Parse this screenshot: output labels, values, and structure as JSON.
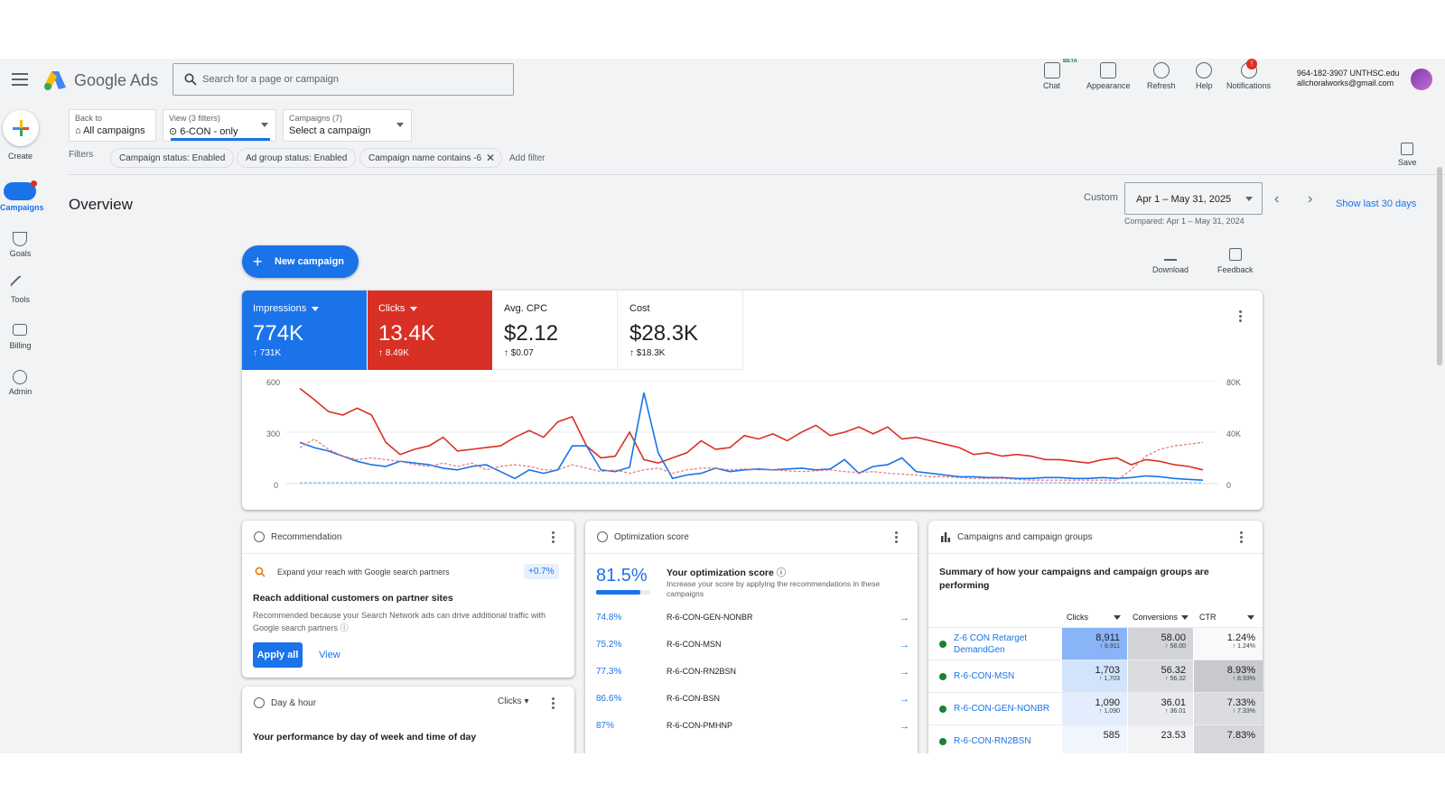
{
  "app": {
    "name": "Google Ads"
  },
  "search": {
    "placeholder": "Search for a page or campaign"
  },
  "header_tools": [
    {
      "label": "Chat",
      "icon": "chat-icon",
      "tag": "BETA"
    },
    {
      "label": "Appearance",
      "icon": "appearance-icon"
    },
    {
      "label": "Refresh",
      "icon": "refresh-icon"
    },
    {
      "label": "Help",
      "icon": "help-icon"
    },
    {
      "label": "Notifications",
      "icon": "bell-icon",
      "badge": "!"
    }
  ],
  "account": {
    "line1": "964-182-3907 UNTHSC.edu",
    "line2": "allchoralworks@gmail.com"
  },
  "sidebar": {
    "create_label": "Create",
    "items": [
      {
        "label": "Campaigns",
        "icon": "megaphone-icon"
      },
      {
        "label": "Goals",
        "icon": "trophy-icon"
      },
      {
        "label": "Tools",
        "icon": "tools-icon"
      },
      {
        "label": "Billing",
        "icon": "billing-icon"
      },
      {
        "label": "Admin",
        "icon": "gear-icon"
      }
    ]
  },
  "breadcrumbs": {
    "back": {
      "small": "Back to",
      "big": "All campaigns"
    },
    "view": {
      "small": "View (3 filters)",
      "big": "6-CON - only"
    },
    "campaigns": {
      "small": "Campaigns (7)",
      "big": "Select a campaign"
    }
  },
  "filters": {
    "label": "Filters",
    "chips": [
      "Campaign status: Enabled",
      "Ad group status: Enabled",
      "Campaign name contains -6"
    ],
    "add": "Add filter"
  },
  "save_label": "Save",
  "overview": {
    "title": "Overview",
    "custom_label": "Custom",
    "date_range": "Apr 1 – May 31, 2025",
    "compared": "Compared: Apr 1 – May 31, 2024",
    "show_last": "Show last 30 days",
    "new_campaign": "New campaign",
    "download": "Download",
    "feedback": "Feedback"
  },
  "metrics": [
    {
      "name": "Impressions",
      "value": "774K",
      "compare": "731K",
      "color": "#1a73e8"
    },
    {
      "name": "Clicks",
      "value": "13.4K",
      "compare": "8.49K",
      "color": "#d93025"
    },
    {
      "name": "Avg. CPC",
      "value": "$2.12",
      "compare": "$0.07"
    },
    {
      "name": "Cost",
      "value": "$28.3K",
      "compare": "$18.3K"
    }
  ],
  "chart_data": {
    "type": "line",
    "left_axis_ticks": [
      "600",
      "300",
      "0"
    ],
    "right_axis_ticks": [
      "80K",
      "40K",
      "0"
    ],
    "ylim_left": [
      0,
      600
    ],
    "ylim_right": [
      0,
      80000
    ],
    "series": [
      {
        "name": "Clicks",
        "color": "#d93025",
        "values": [
          555,
          490,
          420,
          400,
          440,
          400,
          240,
          170,
          200,
          220,
          270,
          190,
          200,
          210,
          220,
          270,
          310,
          270,
          360,
          390,
          220,
          150,
          160,
          300,
          140,
          120,
          150,
          180,
          250,
          200,
          210,
          280,
          260,
          290,
          250,
          300,
          340,
          280,
          300,
          330,
          290,
          330,
          260,
          270,
          250,
          230,
          210,
          170,
          180,
          160,
          170,
          160,
          140,
          140,
          130,
          120,
          140,
          150,
          110,
          140,
          130,
          110,
          100,
          80
        ]
      },
      {
        "name": "Impressions",
        "color": "#1a73e8",
        "values": [
          240,
          210,
          190,
          160,
          130,
          110,
          100,
          130,
          120,
          110,
          90,
          80,
          100,
          110,
          70,
          30,
          80,
          60,
          80,
          220,
          220,
          80,
          70,
          95,
          530,
          180,
          30,
          50,
          60,
          90,
          70,
          80,
          85,
          80,
          85,
          90,
          80,
          85,
          140,
          60,
          100,
          110,
          150,
          70,
          60,
          50,
          40,
          40,
          35,
          35,
          30,
          30,
          35,
          35,
          30,
          30,
          35,
          30,
          35,
          45,
          40,
          30,
          25,
          20
        ]
      },
      {
        "name": "Clicks (compared)",
        "color": "#e57373",
        "dashed": true,
        "values": [
          210,
          260,
          200,
          160,
          140,
          150,
          140,
          130,
          110,
          100,
          120,
          100,
          120,
          80,
          100,
          110,
          100,
          80,
          80,
          110,
          90,
          70,
          80,
          60,
          80,
          90,
          60,
          80,
          90,
          90,
          80,
          85,
          80,
          80,
          75,
          70,
          75,
          80,
          70,
          65,
          70,
          60,
          55,
          50,
          40,
          40,
          35,
          30,
          30,
          30,
          25,
          20,
          20,
          20,
          20,
          20,
          20,
          20,
          80,
          160,
          200,
          220,
          230,
          240
        ]
      },
      {
        "name": "Impressions (compared)",
        "color": "#8ab4f8",
        "dashed": true,
        "values": [
          5,
          5,
          5,
          5,
          5,
          5,
          5,
          5,
          5,
          5,
          5,
          5,
          5,
          5,
          5,
          5,
          5,
          5,
          5,
          5,
          5,
          5,
          5,
          5,
          5,
          5,
          5,
          5,
          5,
          5,
          5,
          5,
          5,
          5,
          5,
          5,
          5,
          5,
          5,
          5,
          5,
          5,
          5,
          5,
          5,
          5,
          5,
          5,
          5,
          5,
          5,
          5,
          5,
          5,
          5,
          5,
          5,
          5,
          5,
          5,
          5,
          5,
          5,
          5
        ]
      }
    ]
  },
  "recommendation": {
    "title": "Recommendation",
    "line": "Expand your reach with Google search partners",
    "badge": "+0.7%",
    "headline": "Reach additional customers on partner sites",
    "body": "Recommended because your Search Network ads can drive additional traffic with Google search partners",
    "apply": "Apply all",
    "view": "View"
  },
  "dayhour": {
    "title": "Day & hour",
    "metric": "Clicks",
    "headline": "Your performance by day of week and time of day"
  },
  "optimization": {
    "title": "Optimization score",
    "score": "81.5%",
    "score_value": 0.815,
    "heading": "Your optimization score",
    "desc": "Increase your score by applying the recommendations in these campaigns",
    "rows": [
      {
        "pct": "74.8%",
        "name": "R-6-CON-GEN-NONBR"
      },
      {
        "pct": "75.2%",
        "name": "R-6-CON-MSN"
      },
      {
        "pct": "77.3%",
        "name": "R-6-CON-RN2BSN"
      },
      {
        "pct": "86.6%",
        "name": "R-6-CON-BSN"
      },
      {
        "pct": "87%",
        "name": "R-6-CON-PMHNP"
      }
    ]
  },
  "campaign_groups": {
    "title": "Campaigns and campaign groups",
    "summary": "Summary of how your campaigns and campaign groups are performing",
    "headers": [
      "Clicks",
      "Conversions",
      "CTR"
    ],
    "rows": [
      {
        "name": "Z-6 CON Retarget DemandGen",
        "clicks": "8,911",
        "clicks_c": "8,911",
        "conv": "58.00",
        "conv_c": "58.00",
        "ctr": "1.24%",
        "ctr_c": "1.24%"
      },
      {
        "name": "R-6-CON-MSN",
        "clicks": "1,703",
        "clicks_c": "1,703",
        "conv": "56.32",
        "conv_c": "56.32",
        "ctr": "8.93%",
        "ctr_c": "8.93%"
      },
      {
        "name": "R-6-CON-GEN-NONBR",
        "clicks": "1,090",
        "clicks_c": "1,090",
        "conv": "36.01",
        "conv_c": "36.01",
        "ctr": "7.33%",
        "ctr_c": "7.33%"
      },
      {
        "name": "R-6-CON-RN2BSN",
        "clicks": "585",
        "clicks_c": "",
        "conv": "23.53",
        "conv_c": "",
        "ctr": "7.83%",
        "ctr_c": ""
      }
    ]
  }
}
